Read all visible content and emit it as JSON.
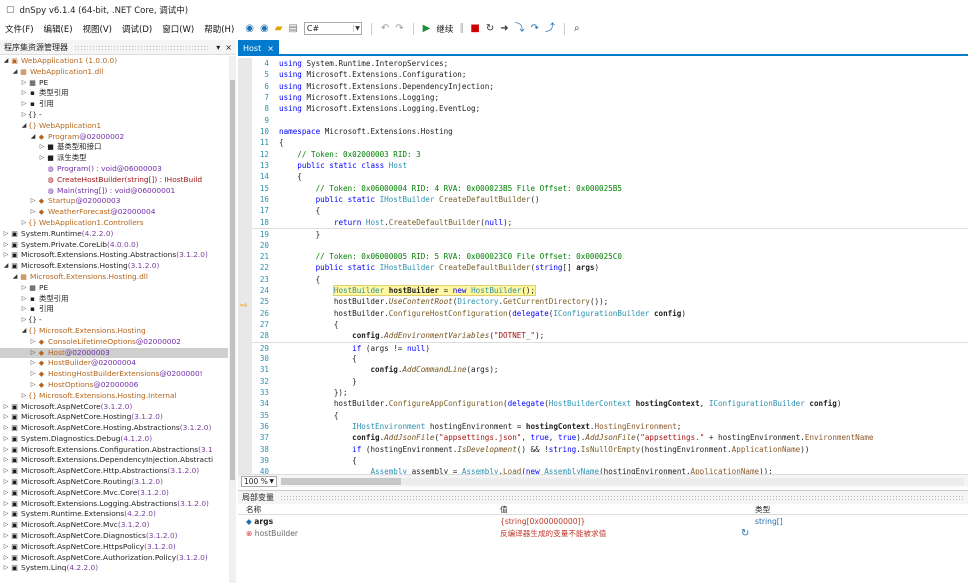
{
  "window": {
    "title": "dnSpy v6.1.4 (64-bit, .NET Core, 调试中)"
  },
  "menu": [
    "文件(F)",
    "编辑(E)",
    "视图(V)",
    "调试(D)",
    "窗口(W)",
    "帮助(H)"
  ],
  "toolbar": {
    "language": "C#",
    "continue_label": "继续"
  },
  "explorer": {
    "title": "程序集资源管理器",
    "close": "×",
    "pin": "▾",
    "rows": [
      {
        "indent": 0,
        "tw": "◢",
        "icon": "▣",
        "cls": "c-org",
        "text": "WebApplication1 (1.0.0.0)"
      },
      {
        "indent": 1,
        "tw": "◢",
        "icon": "▦",
        "cls": "c-org",
        "text": "WebApplication1.dll"
      },
      {
        "indent": 2,
        "tw": "▷",
        "icon": "▦",
        "cls": "c-dark",
        "text": "PE"
      },
      {
        "indent": 2,
        "tw": "▷",
        "icon": "▪",
        "cls": "c-dark",
        "text": "类型引用"
      },
      {
        "indent": 2,
        "tw": "▷",
        "icon": "▪",
        "cls": "c-dark",
        "text": "引用"
      },
      {
        "indent": 2,
        "tw": "▷",
        "icon": "{}",
        "cls": "c-dark",
        "text": "-"
      },
      {
        "indent": 2,
        "tw": "◢",
        "icon": "{}",
        "cls": "c-org",
        "text": "WebApplication1"
      },
      {
        "indent": 3,
        "tw": "◢",
        "icon": "◆",
        "cls": "c-org",
        "text": "Program",
        "meta": "@02000002"
      },
      {
        "indent": 4,
        "tw": "▷",
        "icon": "■",
        "cls": "c-dark",
        "text": "基类型和接口"
      },
      {
        "indent": 4,
        "tw": "▷",
        "icon": "■",
        "cls": "c-dark",
        "text": "派生类型"
      },
      {
        "indent": 4,
        "tw": "",
        "icon": "◍",
        "cls": "c-pur",
        "text": "Program() : void",
        "meta": "@06000003"
      },
      {
        "indent": 4,
        "tw": "",
        "icon": "◍",
        "cls": "c-mag",
        "text": "CreateHostBuilder(string[]) : IHostBuild"
      },
      {
        "indent": 4,
        "tw": "",
        "icon": "◍",
        "cls": "c-pur",
        "text": "Main(string[]) : void",
        "meta": "@06000001"
      },
      {
        "indent": 3,
        "tw": "▷",
        "icon": "◆",
        "cls": "c-org",
        "text": "Startup",
        "meta": "@02000003"
      },
      {
        "indent": 3,
        "tw": "▷",
        "icon": "◆",
        "cls": "c-org",
        "text": "WeatherForecast",
        "meta": "@02000004"
      },
      {
        "indent": 2,
        "tw": "▷",
        "icon": "{}",
        "cls": "c-org",
        "text": "WebApplication1.Controllers"
      },
      {
        "indent": 0,
        "tw": "▷",
        "icon": "▣",
        "cls": "c-dark",
        "text": "System.Runtime",
        "meta": "(4.2.2.0)"
      },
      {
        "indent": 0,
        "tw": "▷",
        "icon": "▣",
        "cls": "c-dark",
        "text": "System.Private.CoreLib",
        "meta": "(4.0.0.0)"
      },
      {
        "indent": 0,
        "tw": "▷",
        "icon": "▣",
        "cls": "c-dark",
        "text": "Microsoft.Extensions.Hosting.Abstractions",
        "meta": "(3.1.2.0)"
      },
      {
        "indent": 0,
        "tw": "◢",
        "icon": "▣",
        "cls": "c-dark",
        "text": "Microsoft.Extensions.Hosting",
        "meta": "(3.1.2.0)"
      },
      {
        "indent": 1,
        "tw": "◢",
        "icon": "▦",
        "cls": "c-org",
        "text": "Microsoft.Extensions.Hosting.dll"
      },
      {
        "indent": 2,
        "tw": "▷",
        "icon": "▦",
        "cls": "c-dark",
        "text": "PE"
      },
      {
        "indent": 2,
        "tw": "▷",
        "icon": "▪",
        "cls": "c-dark",
        "text": "类型引用"
      },
      {
        "indent": 2,
        "tw": "▷",
        "icon": "▪",
        "cls": "c-dark",
        "text": "引用"
      },
      {
        "indent": 2,
        "tw": "▷",
        "icon": "{}",
        "cls": "c-dark",
        "text": "-"
      },
      {
        "indent": 2,
        "tw": "◢",
        "icon": "{}",
        "cls": "c-org",
        "text": "Microsoft.Extensions.Hosting"
      },
      {
        "indent": 3,
        "tw": "▷",
        "icon": "◆",
        "cls": "c-org",
        "text": "ConsoleLifetimeOptions",
        "meta": "@02000002"
      },
      {
        "indent": 3,
        "tw": "▷",
        "icon": "◆",
        "cls": "c-org",
        "text": "Host",
        "meta": "@02000003",
        "sel": true
      },
      {
        "indent": 3,
        "tw": "▷",
        "icon": "◆",
        "cls": "c-org",
        "text": "HostBuilder",
        "meta": "@02000004"
      },
      {
        "indent": 3,
        "tw": "▷",
        "icon": "◆",
        "cls": "c-org",
        "text": "HostingHostBuilderExtensions",
        "meta": "@0200000!"
      },
      {
        "indent": 3,
        "tw": "▷",
        "icon": "◆",
        "cls": "c-org",
        "text": "HostOptions",
        "meta": "@02000006"
      },
      {
        "indent": 2,
        "tw": "▷",
        "icon": "{}",
        "cls": "c-org",
        "text": "Microsoft.Extensions.Hosting.Internal"
      },
      {
        "indent": 0,
        "tw": "▷",
        "icon": "▣",
        "cls": "c-dark",
        "text": "Microsoft.AspNetCore",
        "meta": "(3.1.2.0)"
      },
      {
        "indent": 0,
        "tw": "▷",
        "icon": "▣",
        "cls": "c-dark",
        "text": "Microsoft.AspNetCore.Hosting",
        "meta": "(3.1.2.0)"
      },
      {
        "indent": 0,
        "tw": "▷",
        "icon": "▣",
        "cls": "c-dark",
        "text": "Microsoft.AspNetCore.Hosting.Abstractions",
        "meta": "(3.1.2.0)"
      },
      {
        "indent": 0,
        "tw": "▷",
        "icon": "▣",
        "cls": "c-dark",
        "text": "System.Diagnostics.Debug",
        "meta": "(4.1.2.0)"
      },
      {
        "indent": 0,
        "tw": "▷",
        "icon": "▣",
        "cls": "c-dark",
        "text": "Microsoft.Extensions.Configuration.Abstractions",
        "meta": "(3.1"
      },
      {
        "indent": 0,
        "tw": "▷",
        "icon": "▣",
        "cls": "c-dark",
        "text": "Microsoft.Extensions.DependencyInjection.Abstracti"
      },
      {
        "indent": 0,
        "tw": "▷",
        "icon": "▣",
        "cls": "c-dark",
        "text": "Microsoft.AspNetCore.Http.Abstractions",
        "meta": "(3.1.2.0)"
      },
      {
        "indent": 0,
        "tw": "▷",
        "icon": "▣",
        "cls": "c-dark",
        "text": "Microsoft.AspNetCore.Routing",
        "meta": "(3.1.2.0)"
      },
      {
        "indent": 0,
        "tw": "▷",
        "icon": "▣",
        "cls": "c-dark",
        "text": "Microsoft.AspNetCore.Mvc.Core",
        "meta": "(3.1.2.0)"
      },
      {
        "indent": 0,
        "tw": "▷",
        "icon": "▣",
        "cls": "c-dark",
        "text": "Microsoft.Extensions.Logging.Abstractions",
        "meta": "(3.1.2.0)"
      },
      {
        "indent": 0,
        "tw": "▷",
        "icon": "▣",
        "cls": "c-dark",
        "text": "System.Runtime.Extensions",
        "meta": "(4.2.2.0)"
      },
      {
        "indent": 0,
        "tw": "▷",
        "icon": "▣",
        "cls": "c-dark",
        "text": "Microsoft.AspNetCore.Mvc",
        "meta": "(3.1.2.0)"
      },
      {
        "indent": 0,
        "tw": "▷",
        "icon": "▣",
        "cls": "c-dark",
        "text": "Microsoft.AspNetCore.Diagnostics",
        "meta": "(3.1.2.0)"
      },
      {
        "indent": 0,
        "tw": "▷",
        "icon": "▣",
        "cls": "c-dark",
        "text": "Microsoft.AspNetCore.HttpsPolicy",
        "meta": "(3.1.2.0)"
      },
      {
        "indent": 0,
        "tw": "▷",
        "icon": "▣",
        "cls": "c-dark",
        "text": "Microsoft.AspNetCore.Authorization.Policy",
        "meta": "(3.1.2.0)"
      },
      {
        "indent": 0,
        "tw": "▷",
        "icon": "▣",
        "cls": "c-dark",
        "text": "System.Linq",
        "meta": "(4.2.2.0)"
      }
    ]
  },
  "editor": {
    "tab_label": "Host",
    "tab_close": "×",
    "zoom": "100 %",
    "lines": [
      {
        "n": "4",
        "h": "<span class='kw'>using</span> <span class='nm'>System.Runtime.InteropServices</span>;"
      },
      {
        "n": "5",
        "h": "<span class='kw'>using</span> <span class='nm'>Microsoft.Extensions.Configuration</span>;"
      },
      {
        "n": "6",
        "h": "<span class='kw'>using</span> <span class='nm'>Microsoft.Extensions.DependencyInjection</span>;"
      },
      {
        "n": "7",
        "h": "<span class='kw'>using</span> <span class='nm'>Microsoft.Extensions.Logging</span>;"
      },
      {
        "n": "8",
        "h": "<span class='kw'>using</span> <span class='nm'>Microsoft.Extensions.Logging.EventLog</span>;"
      },
      {
        "n": "9",
        "h": ""
      },
      {
        "n": "10",
        "h": "<span class='kw'>namespace</span> <span class='nm'>Microsoft.Extensions.Hosting</span>"
      },
      {
        "n": "11",
        "h": "{"
      },
      {
        "n": "12",
        "h": "    <span class='cm'>// Token: 0x02000003 RID: 3</span>"
      },
      {
        "n": "13",
        "h": "    <span class='kw'>public static class</span> <span class='ty'>Host</span>"
      },
      {
        "n": "14",
        "h": "    {"
      },
      {
        "n": "15",
        "h": "        <span class='cm'>// Token: 0x06000004 RID: 4 RVA: 0x000023B5 File Offset: 0x000025B5</span>"
      },
      {
        "n": "16",
        "h": "        <span class='kw'>public static</span> <span class='ty'>IHostBuilder</span> <span class='mt'>CreateDefaultBuilder</span>()"
      },
      {
        "n": "17",
        "h": "        {"
      },
      {
        "n": "18",
        "h": "            <span class='kw'>return</span> <span class='ty'>Host</span>.<span class='mt'>CreateDefaultBuilder</span>(<span class='kw'>null</span>);"
      },
      {
        "n": "19",
        "h": "        }",
        "sep": true
      },
      {
        "n": "20",
        "h": ""
      },
      {
        "n": "21",
        "h": "        <span class='cm'>// Token: 0x06000005 RID: 5 RVA: 0x000023C0 File Offset: 0x000025C0</span>"
      },
      {
        "n": "22",
        "h": "        <span class='kw'>public static</span> <span class='ty'>IHostBuilder</span> <span class='mt'>CreateDefaultBuilder</span>(<span class='kw'>string</span>[] <b>args</b>)"
      },
      {
        "n": "23",
        "h": "        {"
      },
      {
        "n": "24",
        "h": "            <span class='hl'><span class='ty'>HostBuilder</span> <b>hostBuilder</b> = <span class='kw'>new</span> <span class='ty'>HostBuilder</span>();</span>"
      },
      {
        "n": "25",
        "h": "            hostBuilder.<span class='ex'>UseContentRoot</span>(<span class='ty'>Directory</span>.<span class='mt'>GetCurrentDirectory</span>());"
      },
      {
        "n": "26",
        "h": "            hostBuilder.<span class='mt'>ConfigureHostConfiguration</span>(<span class='kw'>delegate</span>(<span class='ty'>IConfigurationBuilder</span> <b>config</b>)"
      },
      {
        "n": "27",
        "h": "            {"
      },
      {
        "n": "28",
        "h": "                <b>config</b>.<span class='ex'>AddEnvironmentVariables</span>(<span class='st'>\"DOTNET_\"</span>);"
      },
      {
        "n": "29",
        "h": "                <span class='kw'>if</span> (args != <span class='kw'>null</span>)",
        "sep": true
      },
      {
        "n": "30",
        "h": "                {"
      },
      {
        "n": "31",
        "h": "                    <b>config</b>.<span class='ex'>AddCommandLine</span>(args);"
      },
      {
        "n": "32",
        "h": "                }"
      },
      {
        "n": "33",
        "h": "            });"
      },
      {
        "n": "34",
        "h": "            hostBuilder.<span class='mt'>ConfigureAppConfiguration</span>(<span class='kw'>delegate</span>(<span class='ty'>HostBuilderContext</span> <b>hostingContext</b>, <span class='ty'>IConfigurationBuilder</span> <b>config</b>)"
      },
      {
        "n": "35",
        "h": "            {"
      },
      {
        "n": "36",
        "h": "                <span class='ty'>IHostEnvironment</span> hostingEnvironment = <b>hostingContext</b>.<span class='pr'>HostingEnvironment</span>;"
      },
      {
        "n": "37",
        "h": "                <b>config</b>.<span class='ex'>AddJsonFile</span>(<span class='st'>\"appsettings.json\"</span>, <span class='kw'>true</span>, <span class='kw'>true</span>).<span class='ex'>AddJsonFile</span>(<span class='st'>\"appsettings.\"</span> + hostingEnvironment.<span class='pr'>EnvironmentName</span>"
      },
      {
        "n": "38",
        "h": "                <span class='kw'>if</span> (hostingEnvironment.<span class='ex'>IsDevelopment</span>() &amp;&amp; !<span class='kw'>string</span>.<span class='mt'>IsNullOrEmpty</span>(hostingEnvironment.<span class='pr'>ApplicationName</span>))"
      },
      {
        "n": "39",
        "h": "                {"
      },
      {
        "n": "40",
        "h": "                    <span class='ty'>Assembly</span> assembly = <span class='ty'>Assembly</span>.<span class='mt'>Load</span>(<span class='kw'>new</span> <span class='ty'>AssemblyName</span>(hostingEnvironment.<span class='pr'>ApplicationName</span>));"
      }
    ]
  },
  "locals": {
    "title": "局部变量",
    "headers": {
      "name": "名称",
      "value": "值",
      "type": "类型"
    },
    "rows": [
      {
        "icon": "◆",
        "name": "args",
        "value": "{string[0x00000000]}",
        "type": "string[]",
        "err": false
      },
      {
        "icon": "⊗",
        "name": "hostBuilder",
        "value": "反编译器生成的变量不能被求值",
        "type": "",
        "err": true,
        "refresh": "↻"
      }
    ]
  },
  "colors": {
    "accent": "#007acc",
    "highlight": "#fff8a0"
  }
}
